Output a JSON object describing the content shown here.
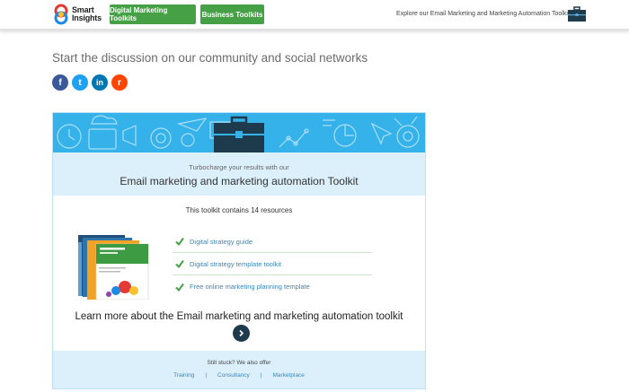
{
  "header": {
    "logo_text_line1": "Smart",
    "logo_text_line2": "Insights",
    "nav": [
      {
        "label": "Digital Marketing Toolkits"
      },
      {
        "label": "Business Toolkits"
      }
    ],
    "explore_text": "Explore our Email Marketing and Marketing Automation Toolkit",
    "briefcase_icon": "briefcase-icon"
  },
  "discussion": {
    "heading": "Start the discussion on our community and social networks",
    "social": [
      {
        "name": "facebook",
        "glyph": "f",
        "color": "#3b5998"
      },
      {
        "name": "twitter",
        "glyph": "t",
        "color": "#1da1f2"
      },
      {
        "name": "linkedin",
        "glyph": "in",
        "color": "#0077b5"
      },
      {
        "name": "reddit",
        "glyph": "r",
        "color": "#ff4500"
      }
    ]
  },
  "toolkit": {
    "banner_color": "#35b2ea",
    "tagline": "Turbocharge your results with our",
    "title": "Email marketing and marketing automation Toolkit",
    "contains": "This toolkit contains 14 resources",
    "resources": [
      {
        "label": "Digital strategy guide"
      },
      {
        "label": "Digital strategy template toolkit"
      },
      {
        "label": "Free online marketing planning template"
      }
    ],
    "learn_more": "Learn more about the Email marketing and marketing automation toolkit",
    "footer": {
      "stuck": "Still stuck? We also offer",
      "links": [
        {
          "label": "Training"
        },
        {
          "label": "Consultancy"
        },
        {
          "label": "Marketplace"
        }
      ],
      "separator": "|"
    }
  },
  "colors": {
    "accent_green": "#45a046",
    "link_blue": "#3a86b8",
    "pale_blue": "#dcf0fb",
    "dark_button": "#1e3a4d"
  }
}
